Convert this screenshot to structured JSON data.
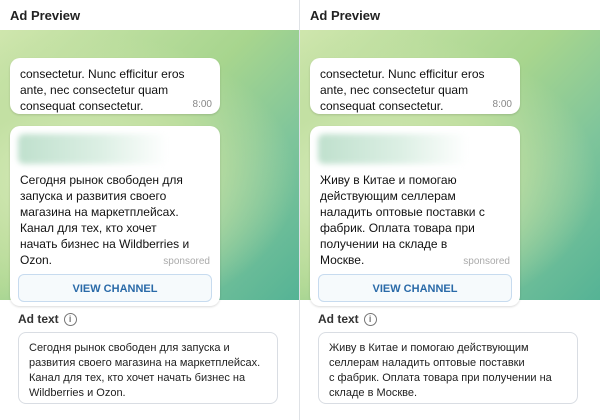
{
  "panels": [
    {
      "title": "Ad Preview",
      "previous_message": "consectetur. Nunc efficitur eros\nante, nec consectetur quam\nconsequat consectetur.",
      "previous_time": "8:00",
      "ad_body": "Сегодня рынок свободен для\nзапуска и развития своего\nмагазина на маркетплейсах.\nКанал для тех, кто хочет\nначать бизнес на Wildberries и\nOzon.",
      "sponsored": "sponsored",
      "button_label": "VIEW CHANNEL",
      "ad_text_label": "Ad text",
      "ad_text_value": "Сегодня рынок свободен для запуска и\nразвития своего магазина на маркетплейсах.\nКанал для тех, кто хочет начать бизнес на\nWildberries и Ozon."
    },
    {
      "title": "Ad Preview",
      "previous_message": "consectetur. Nunc efficitur eros\nante, nec consectetur quam\nconsequat consectetur.",
      "previous_time": "8:00",
      "ad_body": "Живу в Китае и помогаю\nдействующим селлерам\nналадить оптовые поставки с\nфабрик. Оплата товара при\nполучении на складе в\nМоскве.",
      "sponsored": "sponsored",
      "button_label": "VIEW CHANNEL",
      "ad_text_label": "Ad text",
      "ad_text_value": "Живу в Китае и помогаю действующим\nселлерам наладить оптовые поставки\nс фабрик. Оплата товара при получении на\nскладе в Москве."
    }
  ],
  "icons": {
    "info": "info-circle-icon"
  }
}
